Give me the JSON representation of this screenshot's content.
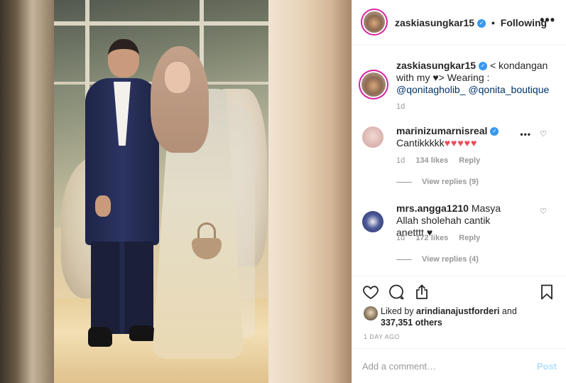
{
  "post": {
    "username": "zaskiasungkar15",
    "follow_status": "Following",
    "header_separator": "•",
    "more_label": "•••"
  },
  "caption": {
    "username": "zaskiasungkar15",
    "text_before_heart": "< kondangan with my",
    "heart": "♥",
    "text_after_heart": "> Wearing :",
    "mention1": "@qonitagholib_",
    "mention2": "@qonita_boutique",
    "time": "1d"
  },
  "comments": [
    {
      "username": "marinizumarnisreal",
      "text": "Cantikkkkk",
      "emoji": "♥♥♥♥♥",
      "time": "1d",
      "likes": "134 likes",
      "reply": "Reply",
      "view_replies": "View replies (9)"
    },
    {
      "username": "mrs.angga1210",
      "text": "Masya Allah sholehah cantik anetttt",
      "emoji": "♥",
      "time": "1d",
      "likes": "172 likes",
      "reply": "Reply",
      "view_replies": "View replies (4)"
    }
  ],
  "likes": {
    "prefix": "Liked by",
    "user": "arindianajustforderi",
    "conjunction": "and",
    "others": "337,351 others"
  },
  "time_ago": "1 DAY AGO",
  "add_comment": {
    "placeholder": "Add a comment…",
    "post_label": "Post"
  },
  "colors": {
    "verified": "#3897f0",
    "link": "#003569",
    "heart": "#ed4956",
    "post_disabled": "#b2dffc"
  }
}
